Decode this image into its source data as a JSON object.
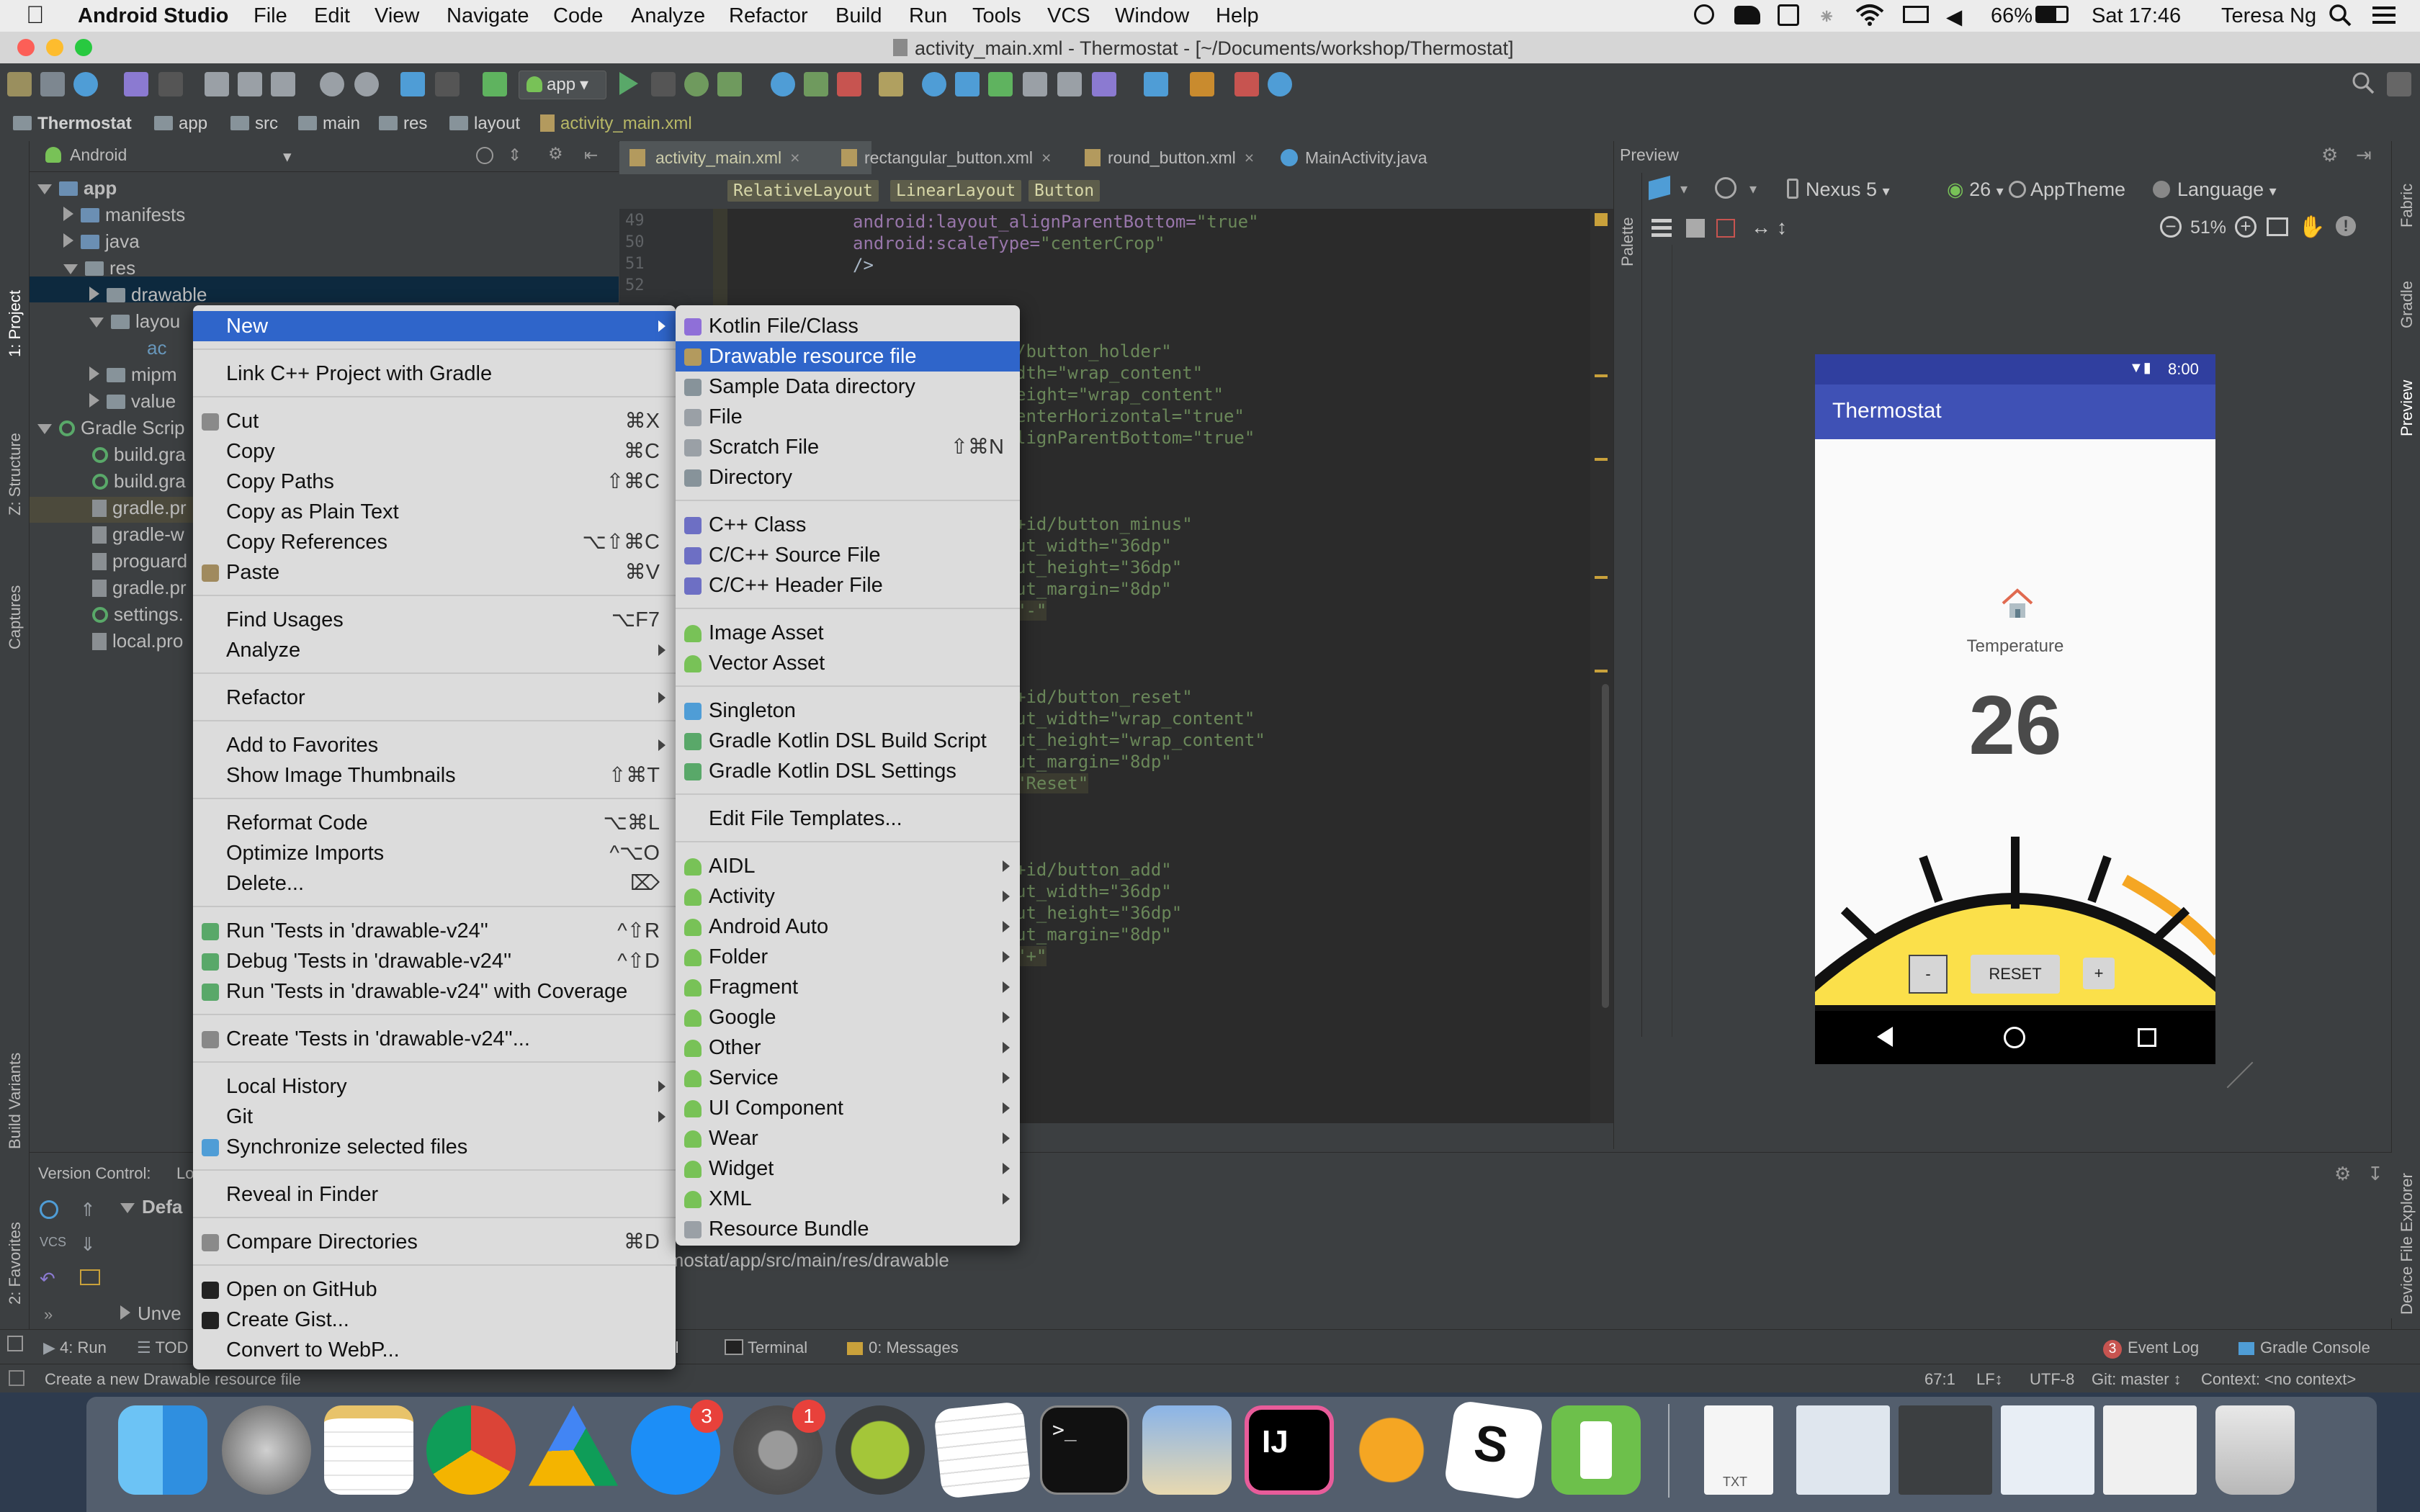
{
  "menubar": {
    "app_name": "Android Studio",
    "items": [
      "File",
      "Edit",
      "View",
      "Navigate",
      "Code",
      "Analyze",
      "Refactor",
      "Build",
      "Run",
      "Tools",
      "VCS",
      "Window",
      "Help"
    ],
    "battery": "66%",
    "clock": "Sat 17:46",
    "user": "Teresa Ng"
  },
  "window_title": "activity_main.xml - Thermostat - [~/Documents/workshop/Thermostat]",
  "toolbar": {
    "run_config": "app"
  },
  "breadcrumbs": [
    "Thermostat",
    "app",
    "src",
    "main",
    "res",
    "layout",
    "activity_main.xml"
  ],
  "side_tabs": {
    "project": "1: Project",
    "structure": "Z: Structure",
    "captures": "Captures",
    "build_variants": "Build Variants",
    "favorites": "2: Favorites",
    "fabric": "Fabric",
    "gradle": "Gradle",
    "preview": "Preview",
    "device_explorer": "Device File Explorer"
  },
  "project": {
    "view_mode": "Android",
    "tree": [
      {
        "label": "app",
        "indent": 0
      },
      {
        "label": "manifests",
        "indent": 1
      },
      {
        "label": "java",
        "indent": 1
      },
      {
        "label": "res",
        "indent": 1
      },
      {
        "label": "drawable",
        "indent": 2
      },
      {
        "label": "layou",
        "indent": 2
      },
      {
        "label": "ac",
        "indent": 3
      },
      {
        "label": "mipm",
        "indent": 2
      },
      {
        "label": "value",
        "indent": 2
      },
      {
        "label": "Gradle Scrip",
        "indent": 0
      },
      {
        "label": "build.gra",
        "indent": 1
      },
      {
        "label": "build.gra",
        "indent": 1
      },
      {
        "label": "gradle.pr",
        "indent": 1
      },
      {
        "label": "gradle-w",
        "indent": 1
      },
      {
        "label": "proguard",
        "indent": 1
      },
      {
        "label": "gradle.pr",
        "indent": 1
      },
      {
        "label": "settings.",
        "indent": 1
      },
      {
        "label": "local.pro",
        "indent": 1
      }
    ]
  },
  "editor": {
    "tabs": [
      "activity_main.xml",
      "rectangular_button.xml",
      "round_button.xml",
      "MainActivity.java"
    ],
    "breadcrumb_tags": [
      "RelativeLayout",
      "LinearLayout",
      "Button"
    ],
    "line_numbers": [
      "49",
      "50",
      "51",
      "52"
    ],
    "lines": [
      {
        "attr": "android:layout_alignParentBottom=",
        "val": "\"true\""
      },
      {
        "attr": "android:scaleType=",
        "val": "\"centerCrop\""
      },
      {
        "attr": "/>",
        "val": ""
      }
    ],
    "fragments": [
      "/button_holder\"",
      "dth=\"wrap_content\"",
      "eight=\"wrap_content\"",
      "enterHorizontal=\"true\"",
      "lignParentBottom=\"true\"",
      "+id/button_minus\"",
      "ut_width=\"36dp\"",
      "ut_height=\"36dp\"",
      "ut_margin=\"8dp\"",
      "\"-\"",
      "+id/button_reset\"",
      "ut_width=\"wrap_content\"",
      "ut_height=\"wrap_content\"",
      "ut_margin=\"8dp\"",
      "\"Reset\"",
      "+id/button_add\"",
      "ut_width=\"36dp\"",
      "ut_height=\"36dp\"",
      "ut_margin=\"8dp\"",
      "\"+\""
    ]
  },
  "preview": {
    "label": "Preview",
    "palette": "Palette",
    "device": "Nexus 5",
    "api": "26",
    "theme": "AppTheme",
    "language": "Language",
    "zoom": "51%",
    "phone": {
      "time": "8:00",
      "app_title": "Thermostat",
      "temperature_label": "Temperature",
      "temperature_value": "26",
      "minus": "-",
      "reset": "RESET",
      "plus": "+"
    }
  },
  "bottom": {
    "version_control": "Version Control:",
    "vc_trunc": "Lo",
    "tree_default": "Defa",
    "tree_unversioned": "Unve",
    "path": "rmostat/app/src/main/res/drawable"
  },
  "tool_tabs": [
    "4: Run",
    "TOD",
    "rol",
    "Terminal",
    "0: Messages"
  ],
  "event_log": "Event Log",
  "event_count": "3",
  "gradle_console": "Gradle Console",
  "status": {
    "message": "Create a new Drawable resource file",
    "position": "67:1",
    "line_sep": "LF↕",
    "encoding": "UTF-8",
    "git": "Git: master ↕",
    "context": "Context: <no context>"
  },
  "context_menu": [
    {
      "label": "New",
      "shortcut": "",
      "submenu": true,
      "selected": true
    },
    {
      "sep": true
    },
    {
      "label": "Link C++ Project with Gradle",
      "shortcut": ""
    },
    {
      "sep": true
    },
    {
      "label": "Cut",
      "shortcut": "⌘X"
    },
    {
      "label": "Copy",
      "shortcut": "⌘C"
    },
    {
      "label": "Copy Paths",
      "shortcut": "⇧⌘C"
    },
    {
      "label": "Copy as Plain Text",
      "shortcut": ""
    },
    {
      "label": "Copy References",
      "shortcut": "⌥⇧⌘C"
    },
    {
      "label": "Paste",
      "shortcut": "⌘V"
    },
    {
      "sep": true
    },
    {
      "label": "Find Usages",
      "shortcut": "⌥F7"
    },
    {
      "label": "Analyze",
      "shortcut": "",
      "submenu": true
    },
    {
      "sep": true
    },
    {
      "label": "Refactor",
      "shortcut": "",
      "submenu": true
    },
    {
      "sep": true
    },
    {
      "label": "Add to Favorites",
      "shortcut": "",
      "submenu": true
    },
    {
      "label": "Show Image Thumbnails",
      "shortcut": "⇧⌘T"
    },
    {
      "sep": true
    },
    {
      "label": "Reformat Code",
      "shortcut": "⌥⌘L"
    },
    {
      "label": "Optimize Imports",
      "shortcut": "^⌥O"
    },
    {
      "label": "Delete...",
      "shortcut": "⌦"
    },
    {
      "sep": true
    },
    {
      "label": "Run 'Tests in 'drawable-v24''",
      "shortcut": "^⇧R"
    },
    {
      "label": "Debug 'Tests in 'drawable-v24''",
      "shortcut": "^⇧D"
    },
    {
      "label": "Run 'Tests in 'drawable-v24'' with Coverage",
      "shortcut": ""
    },
    {
      "sep": true
    },
    {
      "label": "Create 'Tests in 'drawable-v24''...",
      "shortcut": ""
    },
    {
      "sep": true
    },
    {
      "label": "Local History",
      "shortcut": "",
      "submenu": true
    },
    {
      "label": "Git",
      "shortcut": "",
      "submenu": true
    },
    {
      "label": "Synchronize selected files",
      "shortcut": ""
    },
    {
      "sep": true
    },
    {
      "label": "Reveal in Finder",
      "shortcut": ""
    },
    {
      "sep": true
    },
    {
      "label": "Compare Directories",
      "shortcut": "⌘D"
    },
    {
      "sep": true
    },
    {
      "label": "Open on GitHub",
      "shortcut": ""
    },
    {
      "label": "Create Gist...",
      "shortcut": ""
    },
    {
      "label": "Convert to WebP...",
      "shortcut": ""
    }
  ],
  "new_submenu": [
    {
      "label": "Kotlin File/Class",
      "shortcut": ""
    },
    {
      "label": "Drawable resource file",
      "shortcut": "",
      "selected": true
    },
    {
      "label": "Sample Data directory",
      "shortcut": ""
    },
    {
      "label": "File",
      "shortcut": ""
    },
    {
      "label": "Scratch File",
      "shortcut": "⇧⌘N"
    },
    {
      "label": "Directory",
      "shortcut": ""
    },
    {
      "sep": true
    },
    {
      "label": "C++ Class",
      "shortcut": ""
    },
    {
      "label": "C/C++ Source File",
      "shortcut": ""
    },
    {
      "label": "C/C++ Header File",
      "shortcut": ""
    },
    {
      "sep": true
    },
    {
      "label": "Image Asset",
      "shortcut": ""
    },
    {
      "label": "Vector Asset",
      "shortcut": ""
    },
    {
      "sep": true
    },
    {
      "label": "Singleton",
      "shortcut": ""
    },
    {
      "label": "Gradle Kotlin DSL Build Script",
      "shortcut": ""
    },
    {
      "label": "Gradle Kotlin DSL Settings",
      "shortcut": ""
    },
    {
      "sep": true
    },
    {
      "label": "Edit File Templates...",
      "shortcut": ""
    },
    {
      "sep": true
    },
    {
      "label": "AIDL",
      "shortcut": "",
      "submenu": true
    },
    {
      "label": "Activity",
      "shortcut": "",
      "submenu": true
    },
    {
      "label": "Android Auto",
      "shortcut": "",
      "submenu": true
    },
    {
      "label": "Folder",
      "shortcut": "",
      "submenu": true
    },
    {
      "label": "Fragment",
      "shortcut": "",
      "submenu": true
    },
    {
      "label": "Google",
      "shortcut": "",
      "submenu": true
    },
    {
      "label": "Other",
      "shortcut": "",
      "submenu": true
    },
    {
      "label": "Service",
      "shortcut": "",
      "submenu": true
    },
    {
      "label": "UI Component",
      "shortcut": "",
      "submenu": true
    },
    {
      "label": "Wear",
      "shortcut": "",
      "submenu": true
    },
    {
      "label": "Widget",
      "shortcut": "",
      "submenu": true
    },
    {
      "label": "XML",
      "shortcut": "",
      "submenu": true
    },
    {
      "label": "Resource Bundle",
      "shortcut": ""
    }
  ],
  "dock": {
    "badges": {
      "app_store": "3",
      "system_prefs": "1"
    },
    "txt_label": "TXT"
  }
}
